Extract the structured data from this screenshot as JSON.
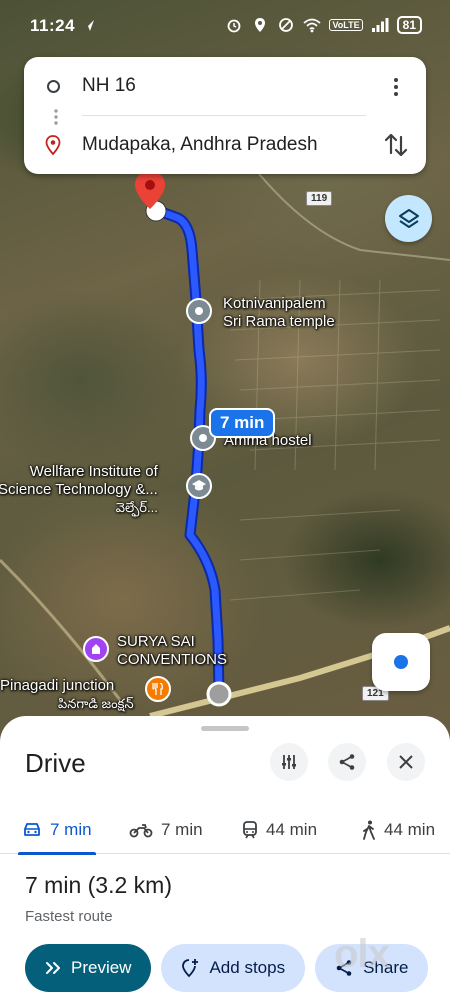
{
  "status_bar": {
    "time": "11:24",
    "volte": "VoLTE",
    "battery": "81"
  },
  "route_card": {
    "origin": "NH 16",
    "destination": "Mudapaka, Andhra Pradesh"
  },
  "map": {
    "route_time_chip": "7 min",
    "road_shields": [
      "119",
      "121"
    ],
    "labels": {
      "temple_line1": "Kotnivanipalem",
      "temple_line2": "Sri Rama temple",
      "hostel": "Amma hostel",
      "institute_line1": "Wellfare Institute of",
      "institute_line2": "Science Technology &...",
      "institute_line3": "వెల్ఫేర్...",
      "conventions_line1": "SURYA SAI",
      "conventions_line2": "CONVENTIONS",
      "junction_line1": "Pinagadi junction",
      "junction_line2": "పినగాడి జంక్షన్"
    },
    "colors": {
      "route": "#1a4bff",
      "destination_pin": "#d93025"
    }
  },
  "sheet": {
    "title": "Drive",
    "modes": [
      {
        "icon": "car-icon",
        "label": "7 min",
        "active": true
      },
      {
        "icon": "motorbike-icon",
        "label": "7 min",
        "active": false
      },
      {
        "icon": "train-icon",
        "label": "44 min",
        "active": false
      },
      {
        "icon": "walk-icon",
        "label": "44 min",
        "active": false
      }
    ],
    "summary": "7 min (3.2 km)",
    "summary_sub": "Fastest route",
    "actions": {
      "preview": "Preview",
      "add_stops": "Add stops",
      "share": "Share"
    },
    "colors": {
      "accent": "#0b57d0",
      "preview_bg": "#04607a"
    }
  },
  "watermark": "olx"
}
